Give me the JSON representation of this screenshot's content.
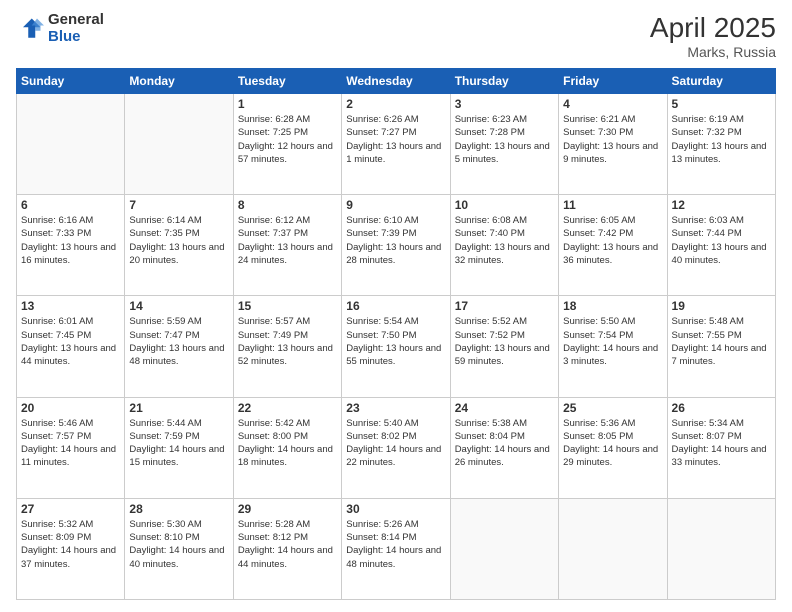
{
  "logo": {
    "general": "General",
    "blue": "Blue"
  },
  "title": {
    "month": "April 2025",
    "location": "Marks, Russia"
  },
  "weekdays": [
    "Sunday",
    "Monday",
    "Tuesday",
    "Wednesday",
    "Thursday",
    "Friday",
    "Saturday"
  ],
  "weeks": [
    [
      {
        "day": "",
        "info": ""
      },
      {
        "day": "",
        "info": ""
      },
      {
        "day": "1",
        "info": "Sunrise: 6:28 AM\nSunset: 7:25 PM\nDaylight: 12 hours and 57 minutes."
      },
      {
        "day": "2",
        "info": "Sunrise: 6:26 AM\nSunset: 7:27 PM\nDaylight: 13 hours and 1 minute."
      },
      {
        "day": "3",
        "info": "Sunrise: 6:23 AM\nSunset: 7:28 PM\nDaylight: 13 hours and 5 minutes."
      },
      {
        "day": "4",
        "info": "Sunrise: 6:21 AM\nSunset: 7:30 PM\nDaylight: 13 hours and 9 minutes."
      },
      {
        "day": "5",
        "info": "Sunrise: 6:19 AM\nSunset: 7:32 PM\nDaylight: 13 hours and 13 minutes."
      }
    ],
    [
      {
        "day": "6",
        "info": "Sunrise: 6:16 AM\nSunset: 7:33 PM\nDaylight: 13 hours and 16 minutes."
      },
      {
        "day": "7",
        "info": "Sunrise: 6:14 AM\nSunset: 7:35 PM\nDaylight: 13 hours and 20 minutes."
      },
      {
        "day": "8",
        "info": "Sunrise: 6:12 AM\nSunset: 7:37 PM\nDaylight: 13 hours and 24 minutes."
      },
      {
        "day": "9",
        "info": "Sunrise: 6:10 AM\nSunset: 7:39 PM\nDaylight: 13 hours and 28 minutes."
      },
      {
        "day": "10",
        "info": "Sunrise: 6:08 AM\nSunset: 7:40 PM\nDaylight: 13 hours and 32 minutes."
      },
      {
        "day": "11",
        "info": "Sunrise: 6:05 AM\nSunset: 7:42 PM\nDaylight: 13 hours and 36 minutes."
      },
      {
        "day": "12",
        "info": "Sunrise: 6:03 AM\nSunset: 7:44 PM\nDaylight: 13 hours and 40 minutes."
      }
    ],
    [
      {
        "day": "13",
        "info": "Sunrise: 6:01 AM\nSunset: 7:45 PM\nDaylight: 13 hours and 44 minutes."
      },
      {
        "day": "14",
        "info": "Sunrise: 5:59 AM\nSunset: 7:47 PM\nDaylight: 13 hours and 48 minutes."
      },
      {
        "day": "15",
        "info": "Sunrise: 5:57 AM\nSunset: 7:49 PM\nDaylight: 13 hours and 52 minutes."
      },
      {
        "day": "16",
        "info": "Sunrise: 5:54 AM\nSunset: 7:50 PM\nDaylight: 13 hours and 55 minutes."
      },
      {
        "day": "17",
        "info": "Sunrise: 5:52 AM\nSunset: 7:52 PM\nDaylight: 13 hours and 59 minutes."
      },
      {
        "day": "18",
        "info": "Sunrise: 5:50 AM\nSunset: 7:54 PM\nDaylight: 14 hours and 3 minutes."
      },
      {
        "day": "19",
        "info": "Sunrise: 5:48 AM\nSunset: 7:55 PM\nDaylight: 14 hours and 7 minutes."
      }
    ],
    [
      {
        "day": "20",
        "info": "Sunrise: 5:46 AM\nSunset: 7:57 PM\nDaylight: 14 hours and 11 minutes."
      },
      {
        "day": "21",
        "info": "Sunrise: 5:44 AM\nSunset: 7:59 PM\nDaylight: 14 hours and 15 minutes."
      },
      {
        "day": "22",
        "info": "Sunrise: 5:42 AM\nSunset: 8:00 PM\nDaylight: 14 hours and 18 minutes."
      },
      {
        "day": "23",
        "info": "Sunrise: 5:40 AM\nSunset: 8:02 PM\nDaylight: 14 hours and 22 minutes."
      },
      {
        "day": "24",
        "info": "Sunrise: 5:38 AM\nSunset: 8:04 PM\nDaylight: 14 hours and 26 minutes."
      },
      {
        "day": "25",
        "info": "Sunrise: 5:36 AM\nSunset: 8:05 PM\nDaylight: 14 hours and 29 minutes."
      },
      {
        "day": "26",
        "info": "Sunrise: 5:34 AM\nSunset: 8:07 PM\nDaylight: 14 hours and 33 minutes."
      }
    ],
    [
      {
        "day": "27",
        "info": "Sunrise: 5:32 AM\nSunset: 8:09 PM\nDaylight: 14 hours and 37 minutes."
      },
      {
        "day": "28",
        "info": "Sunrise: 5:30 AM\nSunset: 8:10 PM\nDaylight: 14 hours and 40 minutes."
      },
      {
        "day": "29",
        "info": "Sunrise: 5:28 AM\nSunset: 8:12 PM\nDaylight: 14 hours and 44 minutes."
      },
      {
        "day": "30",
        "info": "Sunrise: 5:26 AM\nSunset: 8:14 PM\nDaylight: 14 hours and 48 minutes."
      },
      {
        "day": "",
        "info": ""
      },
      {
        "day": "",
        "info": ""
      },
      {
        "day": "",
        "info": ""
      }
    ]
  ]
}
